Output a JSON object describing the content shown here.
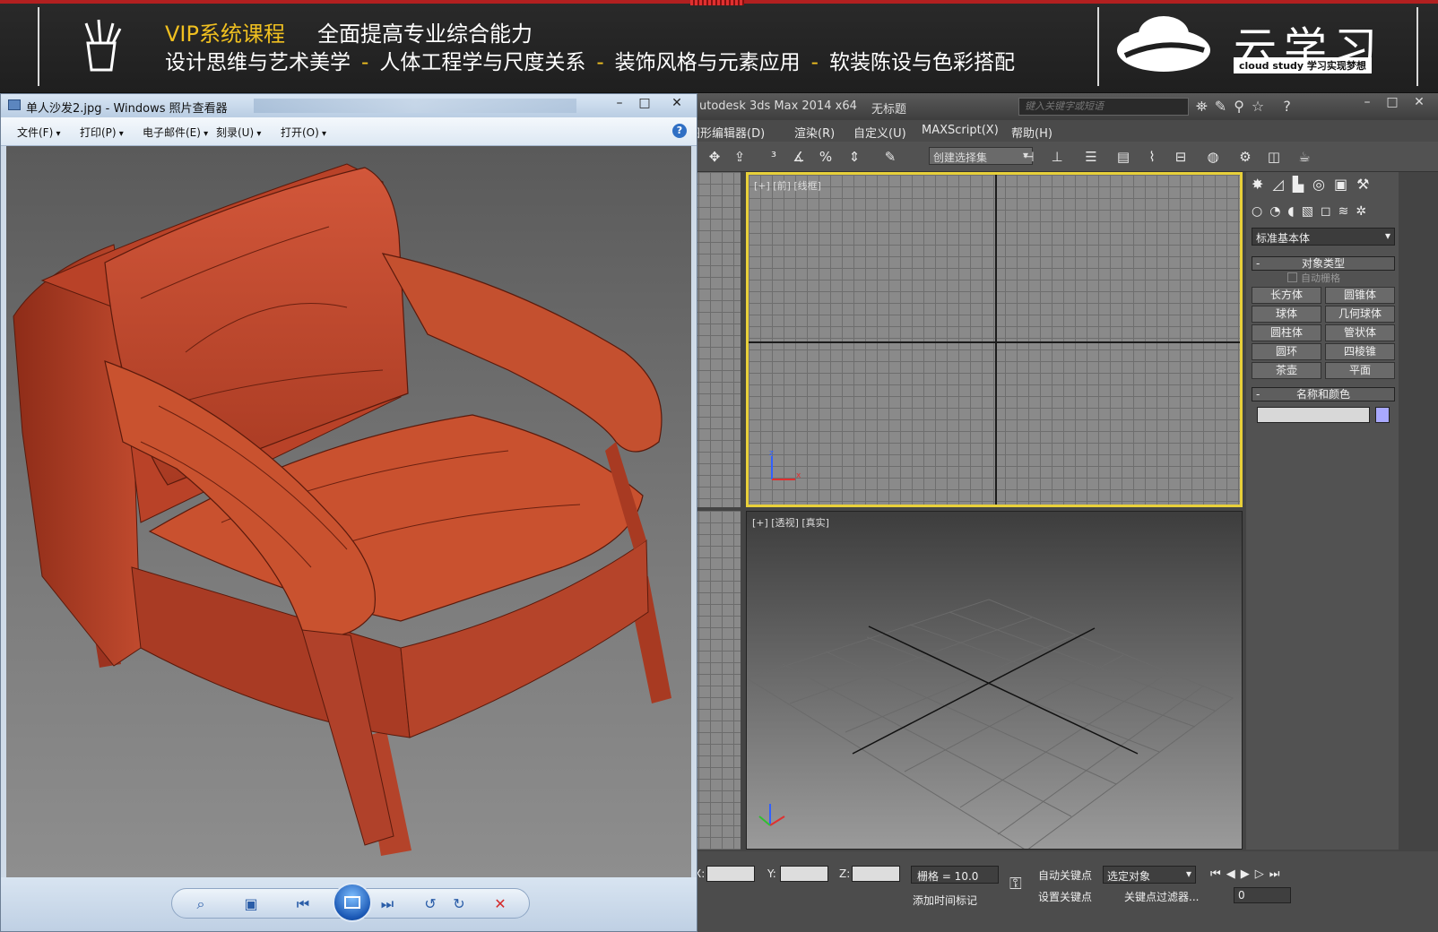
{
  "banner": {
    "vip": "VIP系统课程",
    "headline": "全面提高专业综合能力",
    "topics": [
      "设计思维与艺术美学",
      "人体工程学与尺度关系",
      "装饰风格与元素应用",
      "软装陈设与色彩搭配"
    ],
    "separator": "-",
    "logo_name": "云学习",
    "logo_sub": "cloud study  学习实现梦想"
  },
  "photo_viewer": {
    "title": "单人沙发2.jpg - Windows 照片查看器",
    "menu": [
      "文件(F)",
      "打印(P)",
      "电子邮件(E)",
      "刻录(U)",
      "打开(O)"
    ],
    "help": "?",
    "window_buttons": [
      "–",
      "□",
      "✕"
    ],
    "controls": {
      "zoom": "⌕",
      "fit": "▣",
      "prev": "⏮",
      "next": "⏭",
      "rotate_ccw": "↺",
      "rotate_cw": "↻",
      "delete": "✕"
    }
  },
  "max": {
    "title": "utodesk 3ds Max  2014 x64",
    "doc": "无标题",
    "search_placeholder": "键入关键字或短语",
    "title_icons": "⛯✎⚲☆ ?",
    "window_buttons": [
      "–",
      "□",
      "✕"
    ],
    "menu": [
      "图形编辑器(D)",
      "渲染(R)",
      "自定义(U)",
      "MAXScript(X)",
      "帮助(H)"
    ],
    "selection_set": "创建选择集",
    "viewport_front_label": "[+] [前] [线框]",
    "viewport_persp_label": "[+] [透视] [真实]",
    "command_panel": {
      "tabs": "✸◿▙◎▣⚒",
      "subtabs": "○◔◖▧◻≋✲",
      "category": "标准基本体",
      "object_type_title": "对象类型",
      "autogrid": "自动栅格",
      "objects": [
        "长方体",
        "圆锥体",
        "球体",
        "几何球体",
        "圆柱体",
        "管状体",
        "圆环",
        "四棱锥",
        "茶壶",
        "平面"
      ],
      "name_color_title": "名称和颜色",
      "rollout_minus": "-"
    },
    "status": {
      "x_label": "X:",
      "y_label": "Y:",
      "z_label": "Z:",
      "grid": "栅格 = 10.0",
      "auto_key": "自动关键点",
      "selected": "选定对象",
      "set_key": "设置关键点",
      "key_filters": "关键点过滤器...",
      "add_time_tag": "添加时间标记",
      "frame": "0",
      "playback": "⏮◀▶▷⏭"
    }
  }
}
